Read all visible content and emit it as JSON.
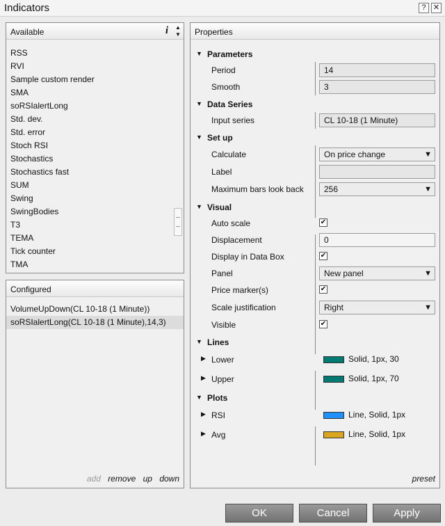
{
  "window": {
    "title": "Indicators",
    "help_label": "?",
    "close_label": "✕"
  },
  "available": {
    "header": "Available",
    "items": [
      "RSS",
      "RVI",
      "Sample custom render",
      "SMA",
      "soRSIalertLong",
      "Std. dev.",
      "Std. error",
      "Stoch RSI",
      "Stochastics",
      "Stochastics fast",
      "SUM",
      "Swing",
      "SwingBodies",
      "T3",
      "TEMA",
      "Tick counter",
      "TMA"
    ]
  },
  "configured": {
    "header": "Configured",
    "items": [
      "VolumeUpDown(CL 10-18 (1 Minute))",
      "soRSIalertLong(CL 10-18 (1 Minute),14,3)"
    ],
    "actions": {
      "add": "add",
      "remove": "remove",
      "up": "up",
      "down": "down"
    }
  },
  "properties": {
    "header": "Properties",
    "parameters": {
      "title": "Parameters",
      "period_label": "Period",
      "period_value": "14",
      "smooth_label": "Smooth",
      "smooth_value": "3"
    },
    "data_series": {
      "title": "Data Series",
      "input_label": "Input series",
      "input_value": "CL 10-18 (1 Minute)"
    },
    "setup": {
      "title": "Set up",
      "calculate_label": "Calculate",
      "calculate_value": "On price change",
      "label_label": "Label",
      "label_value": "",
      "maxbars_label": "Maximum bars look back",
      "maxbars_value": "256"
    },
    "visual": {
      "title": "Visual",
      "autoscale_label": "Auto scale",
      "autoscale_checked": true,
      "displacement_label": "Displacement",
      "displacement_value": "0",
      "databox_label": "Display in Data Box",
      "databox_checked": true,
      "panel_label": "Panel",
      "panel_value": "New panel",
      "pricemarker_label": "Price marker(s)",
      "pricemarker_checked": true,
      "scalejust_label": "Scale justification",
      "scalejust_value": "Right",
      "visible_label": "Visible",
      "visible_checked": true
    },
    "lines": {
      "title": "Lines",
      "lower_label": "Lower",
      "lower_value": "Solid, 1px, 30",
      "lower_color": "#007a72",
      "upper_label": "Upper",
      "upper_value": "Solid, 1px, 70",
      "upper_color": "#007a72"
    },
    "plots": {
      "title": "Plots",
      "rsi_label": "RSI",
      "rsi_value": "Line, Solid, 1px",
      "rsi_color": "#1e90ff",
      "avg_label": "Avg",
      "avg_value": "Line, Solid, 1px",
      "avg_color": "#daa520"
    },
    "preset": "preset"
  },
  "buttons": {
    "ok": "OK",
    "cancel": "Cancel",
    "apply": "Apply"
  }
}
